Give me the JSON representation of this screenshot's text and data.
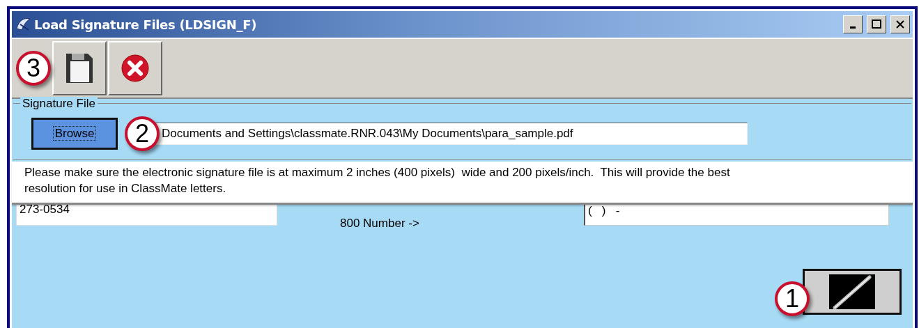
{
  "window": {
    "title": "Load Signature Files (LDSIGN_F)"
  },
  "toolbar": {
    "callout": "3"
  },
  "signature_file": {
    "legend": "Signature File",
    "browse_button": "Browse",
    "callout": "2",
    "path": "Documents and Settings\\classmate.RNR.043\\My Documents\\para_sample.pdf"
  },
  "notice": "Please make sure the electronic signature file is at maximum 2 inches (400 pixels)  wide and 200 pixels/inch.  This will provide the best resolution for use in ClassMate letters.",
  "form": {
    "phone": "273-0534",
    "label": "800 Number ->",
    "number_800": "(   )   -"
  },
  "signature_button": {
    "callout": "1"
  }
}
